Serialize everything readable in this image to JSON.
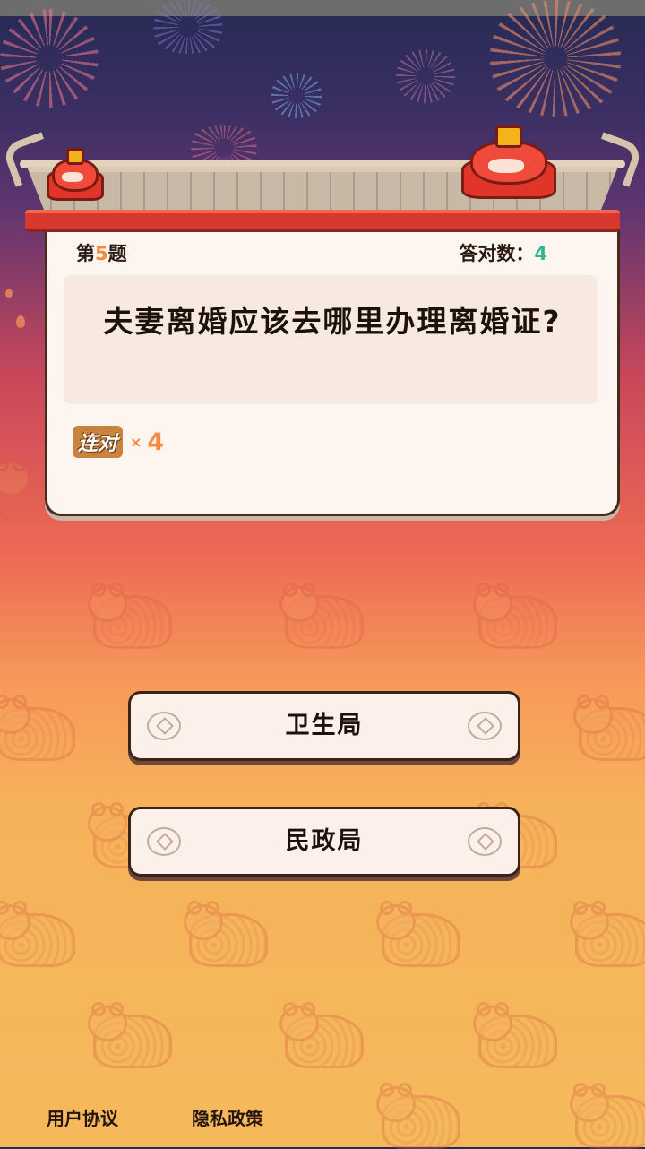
{
  "question": {
    "number_prefix": "第",
    "number": "5",
    "number_suffix": "题",
    "correct_label": "答对数：",
    "correct_count": "4",
    "text": "夫妻离婚应该去哪里办理离婚证?",
    "combo_label": "连对",
    "combo_x": "×",
    "combo_count": "4"
  },
  "answers": [
    {
      "label": "卫生局"
    },
    {
      "label": "民政局"
    }
  ],
  "footer": {
    "user_agreement": "用户协议",
    "privacy_policy": "隐私政策"
  },
  "colors": {
    "accent_orange": "#f48a3d",
    "accent_green": "#30b58c",
    "card_bg": "#fdf5ef",
    "beam_red": "#d8392f"
  },
  "icons": [
    "coin-icon",
    "tiger-toy-icon",
    "tiger-pattern-icon",
    "firework-icon"
  ]
}
